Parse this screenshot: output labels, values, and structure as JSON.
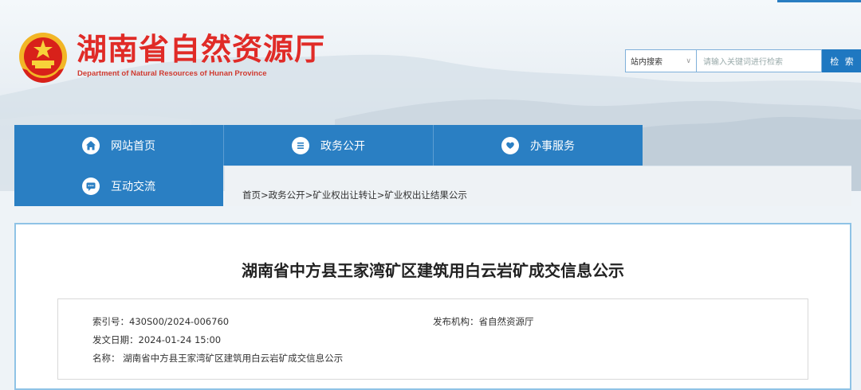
{
  "header": {
    "site_title": "湖南省自然资源厅",
    "site_subtitle": "Department of Natural Resources of Hunan Province",
    "emblem_icon": "national-emblem-icon"
  },
  "search": {
    "scope_label": "站内搜索",
    "placeholder": "请输入关键词进行检索",
    "button_label": "检 索"
  },
  "nav": {
    "items": [
      {
        "label": "网站首页",
        "icon": "home-icon"
      },
      {
        "label": "政务公开",
        "icon": "document-list-icon"
      },
      {
        "label": "办事服务",
        "icon": "heart-hands-icon"
      },
      {
        "label": "互动交流",
        "icon": "chat-icon"
      }
    ]
  },
  "breadcrumb": {
    "text": "首页>政务公开>矿业权出让转让>矿业权出让结果公示"
  },
  "article": {
    "title": "湖南省中方县王家湾矿区建筑用白云岩矿成交信息公示",
    "index_no": "索引号：430S00/2024-006760",
    "publisher": "发布机构：省自然资源厅",
    "date": "发文日期：2024-01-24 15:00",
    "name": "名称： 湖南省中方县王家湾矿区建筑用白云岩矿成交信息公示"
  },
  "colors": {
    "nav_blue": "#2a7fc3",
    "title_red": "#e02b27",
    "border_blue": "#8fc3e6"
  }
}
